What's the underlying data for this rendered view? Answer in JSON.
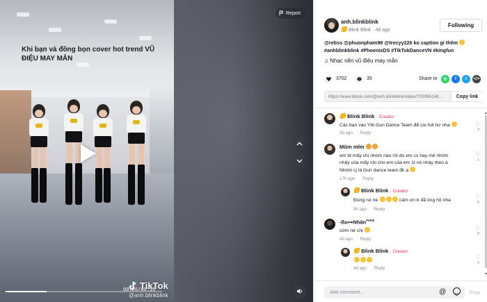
{
  "video": {
    "caption": "Khi bạn và đồng bọn cover hot trend VŨ ĐIỆU MAY MẮN",
    "time": "00:05/00:19",
    "progress": 0.26,
    "brand": "TikTok",
    "username_mark": "@anh.blinkblink",
    "report_label": "Report"
  },
  "author": {
    "username": "anh.blinkblink",
    "nickname": "Blink Blink",
    "posted": "4d ago",
    "follow_label": "Following"
  },
  "post": {
    "description_line1": "@rebss @phuonpham98 @trecyy226 ko caption gì thêm",
    "description_line2": "#anhblinkblink #PhoenixDS #TikTokDanceVN #kingfun",
    "music": "Nhạc nền vũ điệu may mắn",
    "likes": "3702",
    "comments": "35",
    "share_label": "Share to",
    "link": "https://www.tiktok.com/@anh.blinkblink/video/702995148...",
    "copy_link_label": "Copy link"
  },
  "comments": [
    {
      "name": "Blink Blink",
      "badge": "· Creator",
      "text": "Các bạn vào Ytb Gun Dance Team để coi full hơ nha",
      "time": "3d ago",
      "reply": "Reply",
      "likes": "4",
      "is_reply": false
    },
    {
      "name": "Mũm mĩm",
      "badge": "",
      "text_line1": "em bt mấy chị nhóm nào rồi do em cx hay mê nhóm",
      "text_line2": "nhảy của mấy chị cho em của em 1t nò nhảy theo á",
      "text_line3": "Nhóm cj là Gun dance team đk ạ",
      "time": "17h ago",
      "reply": "Reply",
      "likes": "1",
      "is_reply": false
    },
    {
      "name": "Blink Blink",
      "badge": "· Creator",
      "text": "Đúng rùi nè",
      "text_suffix": "cảm ơn b đã ủng hộ nha",
      "time": "9h ago",
      "reply": "Reply",
      "likes": "0",
      "is_reply": true
    },
    {
      "name": "-ßɢ⊶Nhân",
      "name_suffix": "FAKE",
      "badge": "",
      "text": "sớm nè chị",
      "time": "4d ago",
      "reply": "Reply",
      "likes": "0",
      "is_reply": false
    },
    {
      "name": "Blink Blink",
      "badge": "· Creator",
      "text": "",
      "time": "4d ago",
      "reply": "Reply",
      "likes": "0",
      "is_reply": true
    }
  ],
  "comment_bar": {
    "placeholder": "Add comment...",
    "post_label": "Post"
  }
}
